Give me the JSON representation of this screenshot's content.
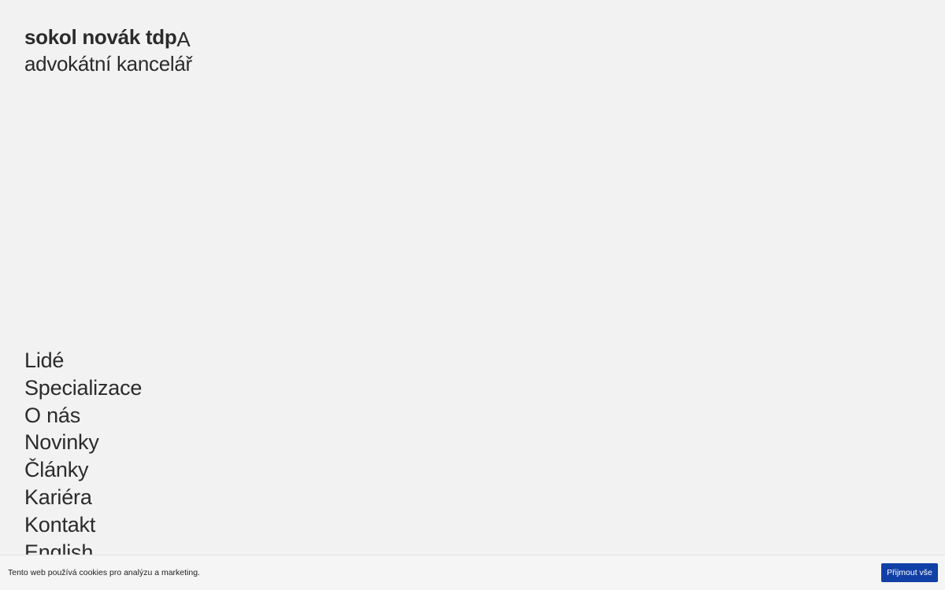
{
  "header": {
    "brand_name": "sokol novák tdp",
    "brand_mark": "A",
    "brand_subtitle": "advokátní kancelář"
  },
  "nav": {
    "items": [
      {
        "label": "Lidé"
      },
      {
        "label": "Specializace"
      },
      {
        "label": "O nás"
      },
      {
        "label": "Novinky"
      },
      {
        "label": "Články"
      },
      {
        "label": "Kariéra"
      },
      {
        "label": "Kontakt"
      },
      {
        "label": "English"
      }
    ]
  },
  "cookie_bar": {
    "text": "Tento web používá cookies pro analýzu a marketing.",
    "accept_label": "Přijmout vše"
  },
  "colors": {
    "background": "#f2f2f2",
    "text": "#2b2b2b",
    "accent": "#1140a6"
  }
}
